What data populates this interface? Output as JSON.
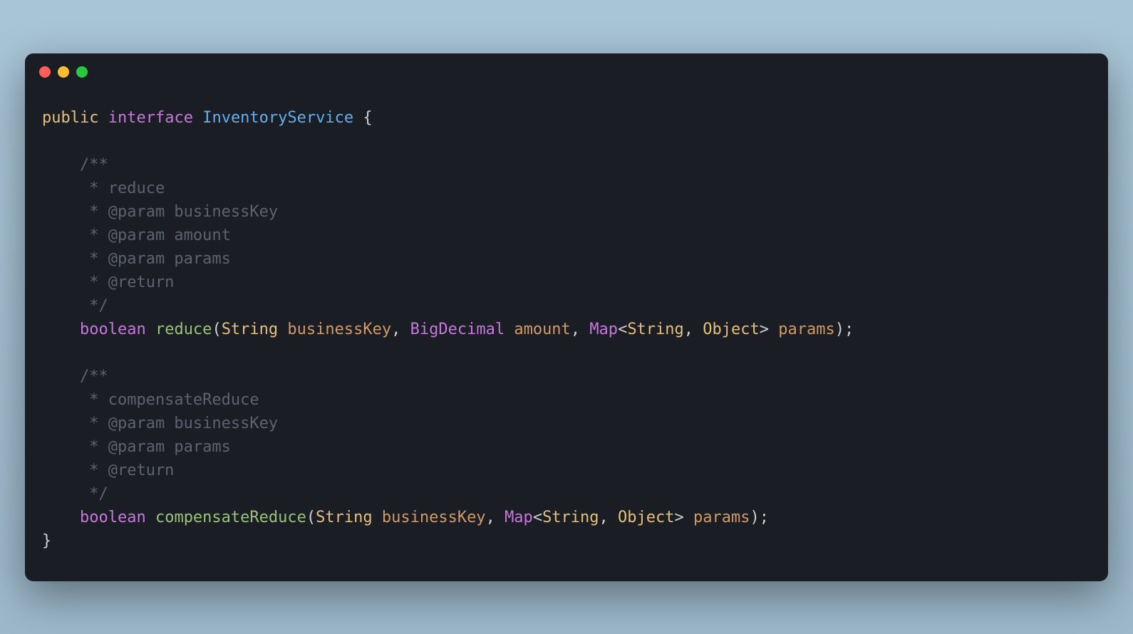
{
  "colors": {
    "red": "#ff5f57",
    "yellow": "#febc2e",
    "green": "#28c840"
  },
  "code": {
    "kw_public": "public",
    "kw_interface": "interface",
    "classname": "InventoryService",
    "open_brace": "{",
    "close_brace": "}",
    "comment1": {
      "open": "/**",
      "l1": "     * reduce",
      "l2_tag": "     * @param",
      "l2_name": " businessKey",
      "l3_tag": "     * @param",
      "l3_name": " amount",
      "l4_tag": "     * @param",
      "l4_name": " params",
      "l5_tag": "     * @return",
      "close": "     */"
    },
    "method1": {
      "kw_boolean": "boolean",
      "name": "reduce",
      "type1": "String",
      "param1": "businessKey",
      "type2": "BigDecimal",
      "param2": "amount",
      "type3": "Map",
      "generic_open": "<",
      "generic_t1": "String",
      "generic_sep": ", ",
      "generic_t2": "Object",
      "generic_close": ">",
      "param3": "params"
    },
    "comment2": {
      "open": "/**",
      "l1": "     * compensateReduce",
      "l2_tag": "     * @param",
      "l2_name": " businessKey",
      "l3_tag": "     * @param",
      "l3_name": " params",
      "l4_tag": "     * @return",
      "close": "     */"
    },
    "method2": {
      "kw_boolean": "boolean",
      "name": "compensateReduce",
      "type1": "String",
      "param1": "businessKey",
      "type2": "Map",
      "generic_open": "<",
      "generic_t1": "String",
      "generic_sep": ", ",
      "generic_t2": "Object",
      "generic_close": ">",
      "param2": "params"
    }
  }
}
